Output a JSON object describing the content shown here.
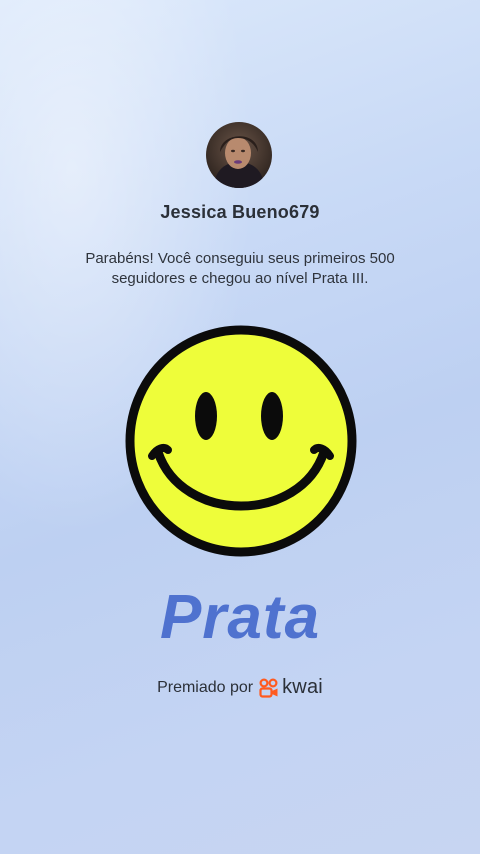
{
  "user": {
    "username": "Jessica Bueno679",
    "avatar_icon": "user-avatar-photo"
  },
  "achievement": {
    "message": "Parabéns! Você conseguiu seus primeiros 500 seguidores e chegou ao nível Prata III.",
    "badge_icon": "smiley-face-icon",
    "level_name": "Prata"
  },
  "footer": {
    "awarded_label": "Premiado por",
    "brand_name": "kwai",
    "brand_icon": "kwai-logo-icon"
  },
  "colors": {
    "level_text": "#4f72cf",
    "smiley_fill": "#eefd3a",
    "smiley_outline": "#0b0b0b",
    "kwai_brand": "#ff5a1f"
  }
}
